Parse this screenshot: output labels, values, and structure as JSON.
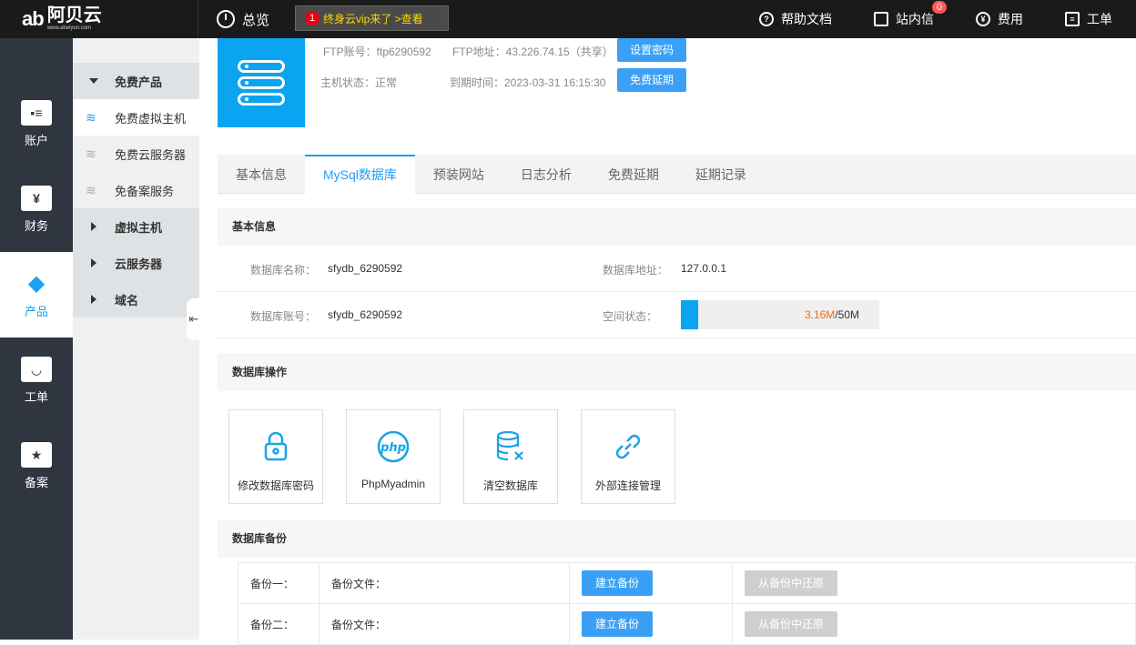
{
  "topbar": {
    "logo_mark": "ab",
    "logo_name": "阿贝云",
    "logo_url": "www.abeiyun.com",
    "overview": "总览",
    "promo_count": "1",
    "promo_text": "终身云vip来了 >查看",
    "nav": [
      {
        "label": "帮助文档",
        "icon": "question-icon"
      },
      {
        "label": "站内信",
        "icon": "mail-icon",
        "badge": "0"
      },
      {
        "label": "费用",
        "icon": "yen-icon"
      },
      {
        "label": "工单",
        "icon": "document-icon"
      }
    ]
  },
  "sidenav": [
    {
      "label": "账户",
      "icon": "id-card-icon"
    },
    {
      "label": "财务",
      "icon": "finance-icon"
    },
    {
      "label": "产品",
      "icon": "products-icon",
      "active": true
    },
    {
      "label": "工单",
      "icon": "bag-icon"
    },
    {
      "label": "备案",
      "icon": "star-doc-icon"
    }
  ],
  "submenu": {
    "free_group": "免费产品",
    "items": [
      "免费虚拟主机",
      "免费云服务器",
      "免备案服务"
    ],
    "groups": [
      "虚拟主机",
      "云服务器",
      "域名"
    ]
  },
  "host": {
    "ftp_account": "FTP账号：ftp6290592",
    "ftp_address": "FTP地址：43.226.74.15（共享）",
    "set_password": "设置密码",
    "status": "主机状态：正常",
    "expire": "到期时间：2023-03-31 16:15:30",
    "free_extend": "免费延期"
  },
  "tabs": [
    "基本信息",
    "MySql数据库",
    "预装网站",
    "日志分析",
    "免费延期",
    "延期记录"
  ],
  "basic_info": {
    "title": "基本信息",
    "db_name_label": "数据库名称：",
    "db_name": "sfydb_6290592",
    "db_addr_label": "数据库地址：",
    "db_addr": "127.0.0.1",
    "db_account_label": "数据库账号：",
    "db_account": "sfydb_6290592",
    "space_label": "空间状态：",
    "space_used": "3.16M",
    "space_total": "/50M",
    "space_fraction": 0.0632
  },
  "operations": {
    "title": "数据库操作",
    "items": [
      {
        "label": "修改数据库密码",
        "icon": "lock-icon"
      },
      {
        "label": "PhpMyadmin",
        "icon": "php-icon"
      },
      {
        "label": "清空数据库",
        "icon": "database-clear-icon"
      },
      {
        "label": "外部连接管理",
        "icon": "link-icon"
      }
    ]
  },
  "backup": {
    "title": "数据库备份",
    "rows": [
      {
        "name": "备份一：",
        "file": "备份文件："
      },
      {
        "name": "备份二：",
        "file": "备份文件："
      }
    ],
    "create": "建立备份",
    "restore": "从备份中还原"
  },
  "colors": {
    "accent": "#1e9ff2",
    "topbar": "#1a1a1a",
    "sidebar": "#2f3640",
    "promo": "#ffd800"
  }
}
